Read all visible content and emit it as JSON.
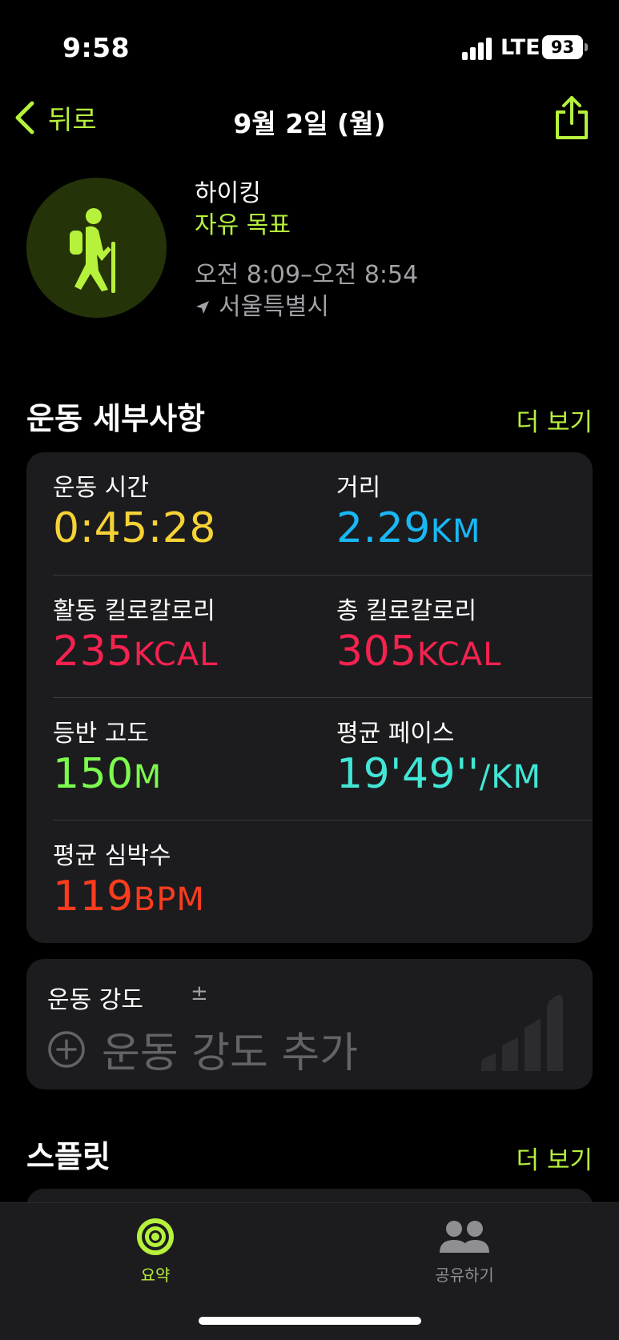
{
  "status_bar": {
    "time": "9:58",
    "network": "LTE",
    "battery": "93"
  },
  "nav": {
    "back_label": "뒤로",
    "title": "9월 2일 (월)"
  },
  "workout": {
    "name": "하이킹",
    "goal": "자유 목표",
    "time_range": "오전 8:09–오전 8:54",
    "location": "서울특별시"
  },
  "details": {
    "title": "운동 세부사항",
    "more_label": "더 보기",
    "metrics": [
      {
        "label": "운동 시간",
        "value": "0:45:28",
        "unit": "",
        "color": "#f5d235"
      },
      {
        "label": "거리",
        "value": "2.29",
        "unit": "KM",
        "color": "#18b8f5"
      },
      {
        "label": "활동 킬로칼로리",
        "value": "235",
        "unit": "KCAL",
        "color": "#f5224f"
      },
      {
        "label": "총 킬로칼로리",
        "value": "305",
        "unit": "KCAL",
        "color": "#f5224f"
      },
      {
        "label": "등반 고도",
        "value": "150",
        "unit": "M",
        "color": "#7dfa4e"
      },
      {
        "label": "평균 페이스",
        "value": "19'49''",
        "unit": "/KM",
        "color": "#42e6d6"
      },
      {
        "label": "평균 심박수",
        "value": "119",
        "unit": "BPM",
        "color": "#fa3c1e"
      }
    ]
  },
  "intensity": {
    "label": "운동 강도",
    "pm_symbol": "±",
    "add_label": "운동 강도 추가"
  },
  "splits": {
    "title": "스플릿",
    "more_label": "더 보기"
  },
  "tabs": [
    {
      "label": "요약",
      "active": true,
      "color": "#b6f13c"
    },
    {
      "label": "공유하기",
      "active": false,
      "color": "#8e8e93"
    }
  ],
  "colors": {
    "accent": "#b6f13c",
    "card": "#1c1c1e",
    "secondary_text": "#a1a1a6"
  }
}
